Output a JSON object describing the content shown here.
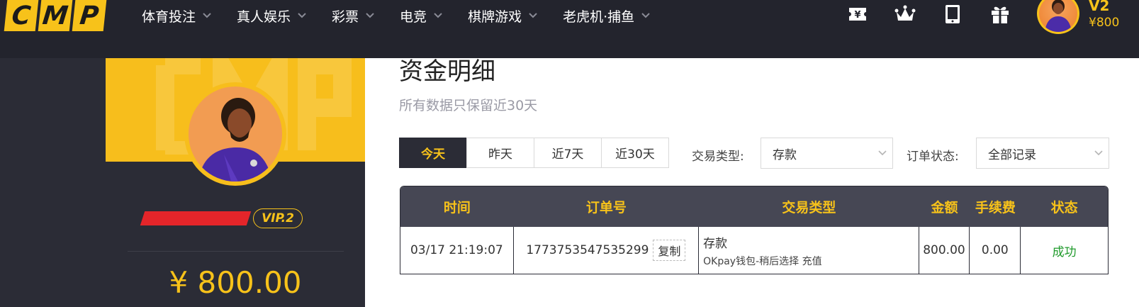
{
  "logo": {
    "letters": [
      "C",
      "M",
      "P"
    ]
  },
  "nav": {
    "items": [
      {
        "label": "体育投注",
        "icon": "chevron-down-icon"
      },
      {
        "label": "真人娱乐",
        "icon": "chevron-down-icon"
      },
      {
        "label": "彩票",
        "icon": "chevron-down-icon"
      },
      {
        "label": "电竞",
        "icon": "chevron-down-icon"
      },
      {
        "label": "棋牌游戏",
        "icon": "chevron-down-icon"
      },
      {
        "label": "老虎机·捕鱼",
        "icon": "chevron-down-icon"
      }
    ]
  },
  "header_icons": [
    "ticket-icon",
    "crown-icon",
    "tablet-icon",
    "gift-icon"
  ],
  "user": {
    "vip_short": "V2",
    "vip_badge": "VIP.2",
    "balance_short": "¥800",
    "balance": "¥ 800.00"
  },
  "page": {
    "title": "资金明细",
    "subtitle": "所有数据只保留近30天"
  },
  "date_tabs": [
    {
      "label": "今天",
      "active": true
    },
    {
      "label": "昨天",
      "active": false
    },
    {
      "label": "近7天",
      "active": false
    },
    {
      "label": "近30天",
      "active": false
    }
  ],
  "filters": {
    "type_label": "交易类型:",
    "type_value": "存款",
    "status_label": "订单状态:",
    "status_value": "全部记录"
  },
  "table": {
    "headers": [
      "时间",
      "订单号",
      "交易类型",
      "金额",
      "手续费",
      "状态"
    ],
    "rows": [
      {
        "time": "03/17 21:19:07",
        "order_no": "1773753547535299",
        "copy_label": "复制",
        "type": "存款",
        "type_detail": "OKpay钱包-稍后选择 充值",
        "amount": "800.00",
        "fee": "0.00",
        "status": "成功"
      }
    ]
  },
  "colors": {
    "accent": "#f7c21a",
    "topbar": "#23242d",
    "dark": "#2b2c36",
    "table_header": "#464754",
    "success": "#1f9a2b",
    "redaction": "#e4252a"
  }
}
